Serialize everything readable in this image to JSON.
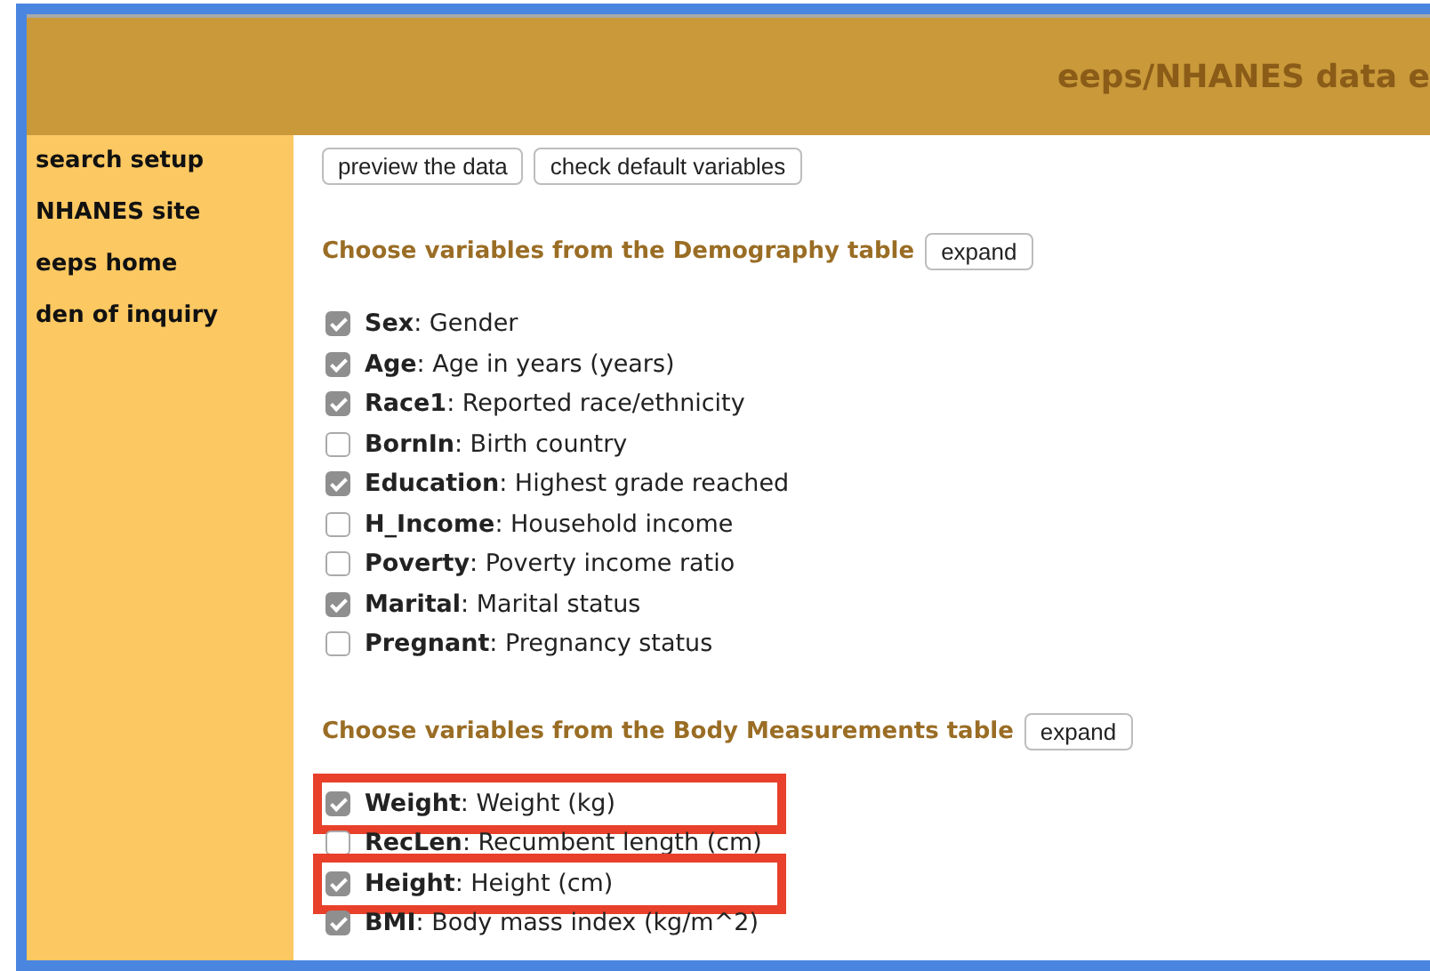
{
  "header": {
    "title": "eeps/NHANES data e"
  },
  "sidebar": {
    "items": [
      {
        "label": "search setup"
      },
      {
        "label": "NHANES site"
      },
      {
        "label": "eeps home"
      },
      {
        "label": "den of inquiry"
      }
    ]
  },
  "toolbar": {
    "buttons": [
      "preview the data",
      "check default variables"
    ]
  },
  "sections": [
    {
      "heading": "Choose variables from the Demography table",
      "button": "expand",
      "variables": [
        {
          "label": "**Sex**: Gender",
          "checked": true,
          "highlighted": false
        },
        {
          "label": "**Age**: Age in years (years)",
          "checked": true,
          "highlighted": false
        },
        {
          "label": "**Race1**: Reported race/ethnicity",
          "checked": true,
          "highlighted": false
        },
        {
          "label": "**BornIn**: Birth country",
          "checked": false,
          "highlighted": false
        },
        {
          "label": "**Education**: Highest grade reached",
          "checked": true,
          "highlighted": false
        },
        {
          "label": "**H_Income**: Household income",
          "checked": false,
          "highlighted": false
        },
        {
          "label": "**Poverty**: Poverty income ratio",
          "checked": false,
          "highlighted": false
        },
        {
          "label": "**Marital**: Marital status",
          "checked": true,
          "highlighted": false
        },
        {
          "label": "**Pregnant**: Pregnancy status",
          "checked": false,
          "highlighted": false
        }
      ]
    },
    {
      "heading": "Choose variables from the Body Measurements table",
      "button": "expand",
      "variables": [
        {
          "label": "**Weight**: Weight (kg)",
          "checked": true,
          "highlighted": true
        },
        {
          "label": "**RecLen**: Recumbent length (cm)",
          "checked": false,
          "highlighted": false
        },
        {
          "label": "**Height**: Height (cm)",
          "checked": true,
          "highlighted": true
        },
        {
          "label": "**BMI**: Body mass index (kg/m^2)",
          "checked": true,
          "highlighted": false
        }
      ]
    }
  ]
}
